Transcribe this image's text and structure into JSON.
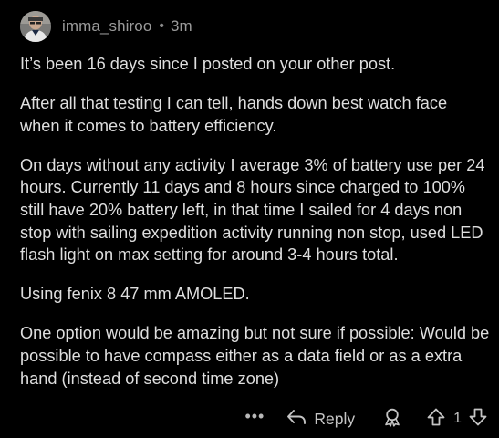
{
  "comment": {
    "author": "imma_shiroo",
    "separator": "•",
    "time_ago": "3m",
    "paragraphs": [
      "It’s been 16 days since I posted on your other post.",
      "After all that testing I can tell, hands down best watch face when it comes to battery efficiency.",
      "On days without any activity I average 3% of battery use per 24 hours. Currently 11 days and 8 hours since charged to 100% still have 20% battery left, in that time I sailed for 4 days non stop with sailing expedition activity running non stop, used LED flash light on max setting for around 3-4 hours total.",
      "Using fenix 8 47 mm AMOLED.",
      "One option would be amazing but not sure if possible: Would be possible to have compass either as a data field or as a extra hand (instead of second time zone)"
    ]
  },
  "actions": {
    "more_label": "•••",
    "reply_label": "Reply",
    "vote_count": "1"
  },
  "icons": {
    "avatar": "avatar",
    "reply": "reply-arrow-icon",
    "award": "award-icon",
    "upvote": "upvote-arrow-icon",
    "downvote": "downvote-arrow-icon"
  },
  "colors": {
    "background": "#000000",
    "text": "#dedede",
    "meta": "#9a9a9a",
    "action": "#b8b8b8"
  }
}
